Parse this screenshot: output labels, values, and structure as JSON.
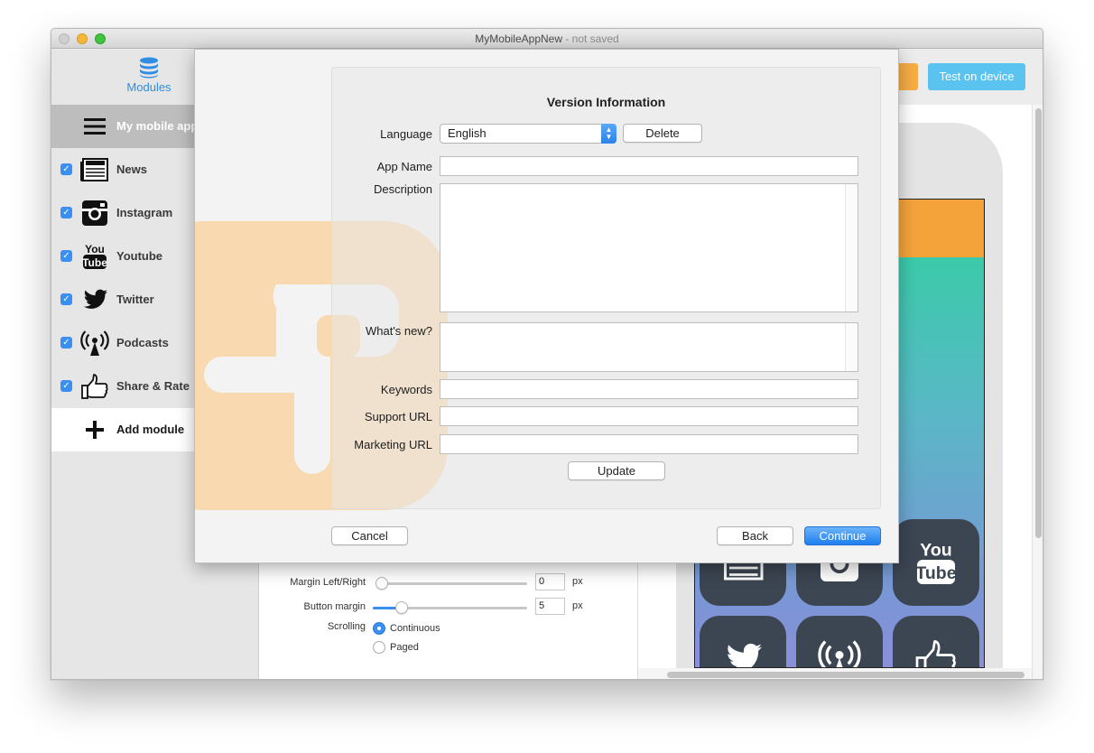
{
  "window": {
    "title": "MyMobileAppNew",
    "title_suffix": " - not saved"
  },
  "sidebar": {
    "tab_label": "Modules",
    "app_item": {
      "label": "My mobile app",
      "icon": "hamburger-menu-icon"
    },
    "items": [
      {
        "label": "News",
        "icon": "newspaper-icon",
        "checked": true
      },
      {
        "label": "Instagram",
        "icon": "instagram-icon",
        "checked": true
      },
      {
        "label": "Youtube",
        "icon": "youtube-icon",
        "checked": true
      },
      {
        "label": "Twitter",
        "icon": "twitter-bird-icon",
        "checked": true
      },
      {
        "label": "Podcasts",
        "icon": "podcast-antenna-icon",
        "checked": true
      },
      {
        "label": "Share & Rate",
        "icon": "thumbs-up-icon",
        "checked": true
      }
    ],
    "add_label": "Add module"
  },
  "toolbar": {
    "test_label": "Test on device",
    "orange_color": "#f6ad44",
    "test_color": "#5bc3ef"
  },
  "settings": {
    "margin_lr_label": "Margin Left/Right",
    "margin_lr_value": "0",
    "margin_lr_level": 0,
    "button_margin_label": "Button margin",
    "button_margin_value": "5",
    "button_margin_level": 0.19,
    "px_unit": "px",
    "scrolling_label": "Scrolling",
    "scroll_options": [
      "Continuous",
      "Paged"
    ],
    "scroll_selected": "Continuous"
  },
  "preview": {
    "header_color": "#f4a33b",
    "tile_icons": [
      "newspaper-icon",
      "instagram-icon",
      "youtube-icon",
      "twitter-bird-icon",
      "podcast-antenna-icon",
      "thumbs-up-icon"
    ],
    "youtube_text_top": "You",
    "youtube_text_bottom": "Tube"
  },
  "sheet": {
    "title": "Version Information",
    "language_label": "Language",
    "language_value": "English",
    "delete_label": "Delete",
    "app_name_label": "App Name",
    "app_name_value": "",
    "description_label": "Description",
    "description_value": "",
    "whats_new_label": "What's new?",
    "whats_new_value": "",
    "keywords_label": "Keywords",
    "keywords_value": "",
    "support_url_label": "Support URL",
    "support_url_value": "",
    "marketing_url_label": "Marketing URL",
    "marketing_url_value": "",
    "update_label": "Update",
    "cancel_label": "Cancel",
    "back_label": "Back",
    "continue_label": "Continue",
    "accent_color": "#2b82ea"
  }
}
